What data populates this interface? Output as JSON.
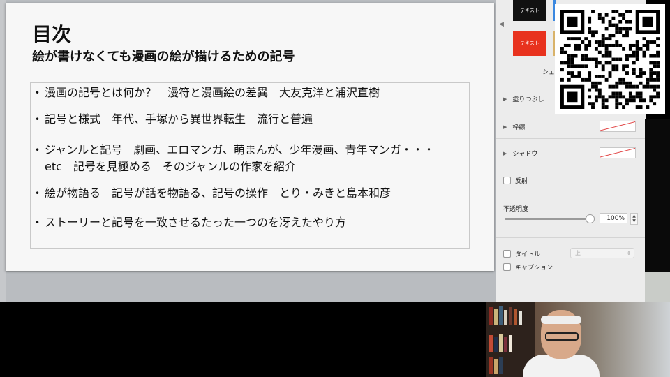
{
  "slide": {
    "title": "目次",
    "subtitle": "絵が書けなくても漫画の絵が描けるための記号",
    "bullets": [
      "漫画の記号とは何か？　漫符と漫画絵の差異　大友克洋と浦沢直樹",
      "記号と様式　年代、手塚から異世界転生　流行と普遍",
      "ジャンルと記号　劇画、エロマンガ、萌まんが、少年漫画、青年マンガ・・・etc　記号を見極める　そのジャンルの作家を紹介",
      "絵が物語る　記号が話を物語る、記号の操作　とり・みきと島本和彦",
      "ストーリーと記号を一致させるたった一つのを冴えたやり方"
    ],
    "bullet_marker": "•"
  },
  "inspector": {
    "style_dark_label": "テキスト",
    "style_red_label": "テキスト",
    "style_caption": "シェ",
    "fill_label": "塗りつぶし",
    "border_label": "枠線",
    "shadow_label": "シャドウ",
    "reflection_label": "反射",
    "opacity_label": "不透明度",
    "opacity_value": "100%",
    "opacity_level": 1.0,
    "title_label": "タイトル",
    "caption_label": "キャプション",
    "title_select_value": "上",
    "nav_icon": "chevron-left-icon",
    "expand_icon": "triangle-right-icon"
  },
  "colors": {
    "style_red": "#e8321e",
    "style_dark": "#111111"
  }
}
